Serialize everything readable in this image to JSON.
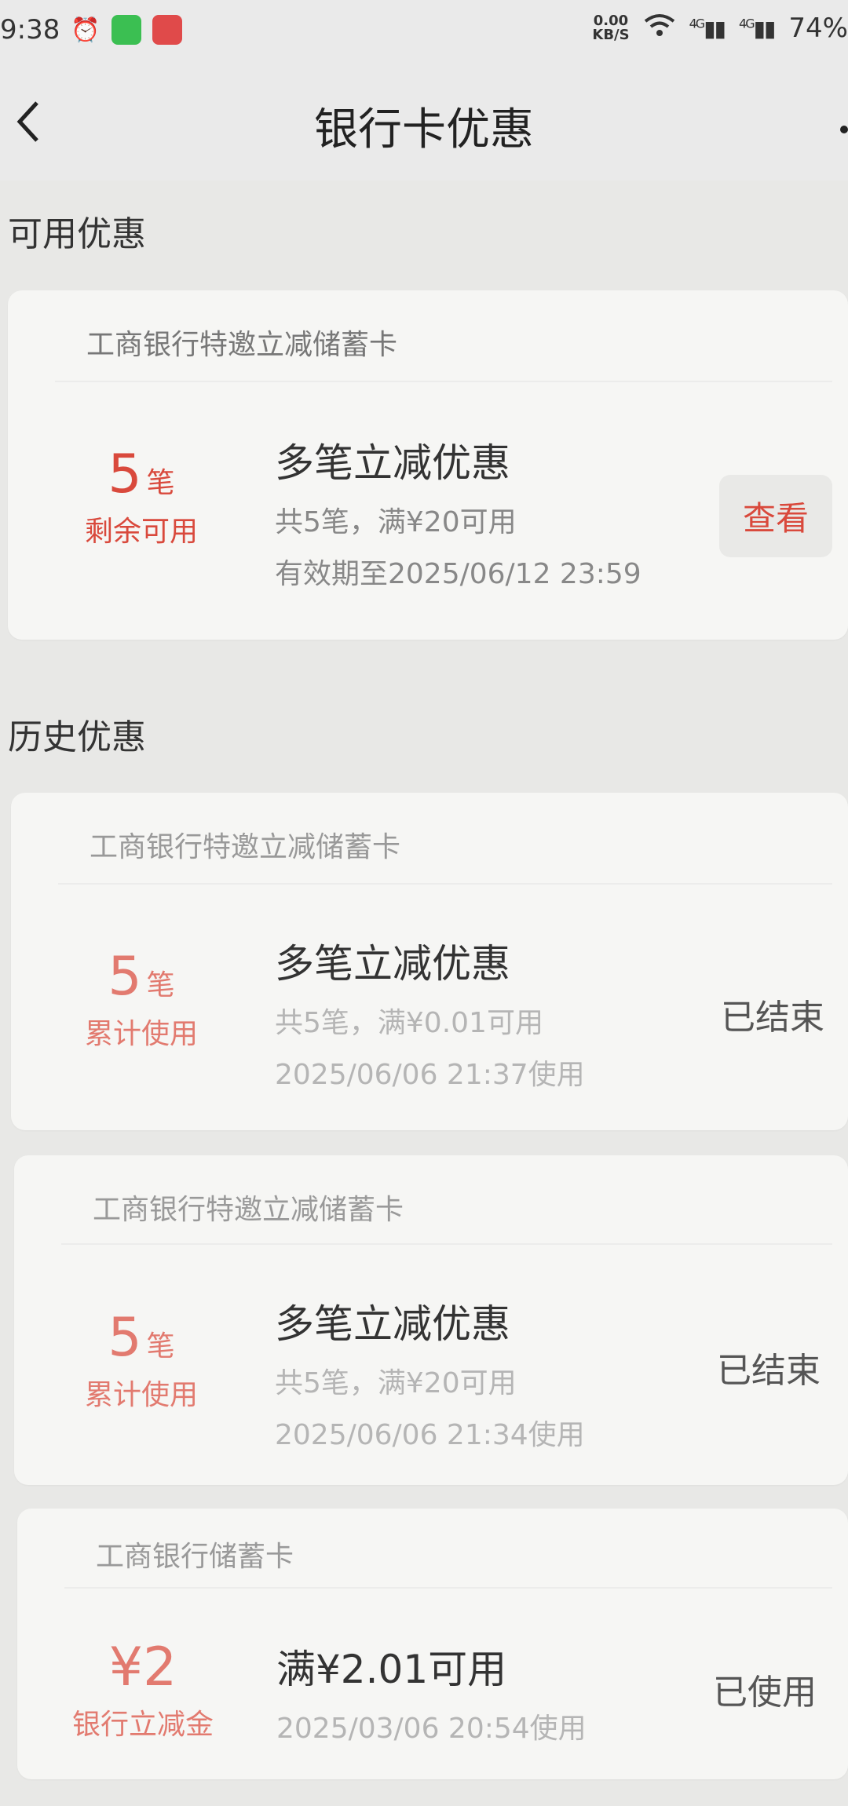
{
  "status_bar": {
    "time": "9:38",
    "net_speed_value": "0.00",
    "net_speed_unit": "KB/S",
    "signal1": "4G",
    "signal2": "4G",
    "battery": "74%"
  },
  "header": {
    "title": "银行卡优惠",
    "back_icon": "chevron-left-icon"
  },
  "sections": {
    "available": "可用优惠",
    "history": "历史优惠"
  },
  "available_card": {
    "bank": "工商银行特邀立减储蓄卡",
    "count": "5",
    "unit": "笔",
    "count_label": "剩余可用",
    "title": "多笔立减优惠",
    "detail": "共5笔，满¥20可用",
    "validity": "有效期至2025/06/12 23:59",
    "action": "查看"
  },
  "history_cards": [
    {
      "bank": "工商银行特邀立减储蓄卡",
      "count": "5",
      "unit": "笔",
      "count_label": "累计使用",
      "title": "多笔立减优惠",
      "detail": "共5笔，满¥0.01可用",
      "time": "2025/06/06 21:37使用",
      "status": "已结束"
    },
    {
      "bank": "工商银行特邀立减储蓄卡",
      "count": "5",
      "unit": "笔",
      "count_label": "累计使用",
      "title": "多笔立减优惠",
      "detail": "共5笔，满¥20可用",
      "time": "2025/06/06 21:34使用",
      "status": "已结束"
    },
    {
      "bank": "工商银行储蓄卡",
      "count": "¥2",
      "unit": "",
      "count_label": "银行立减金",
      "title": "满¥2.01可用",
      "detail": "",
      "time": "2025/03/06 20:54使用",
      "status": "已使用"
    }
  ],
  "colors": {
    "accent": "#d9493c",
    "background": "#e8e8e6",
    "card": "#f6f6f4"
  }
}
